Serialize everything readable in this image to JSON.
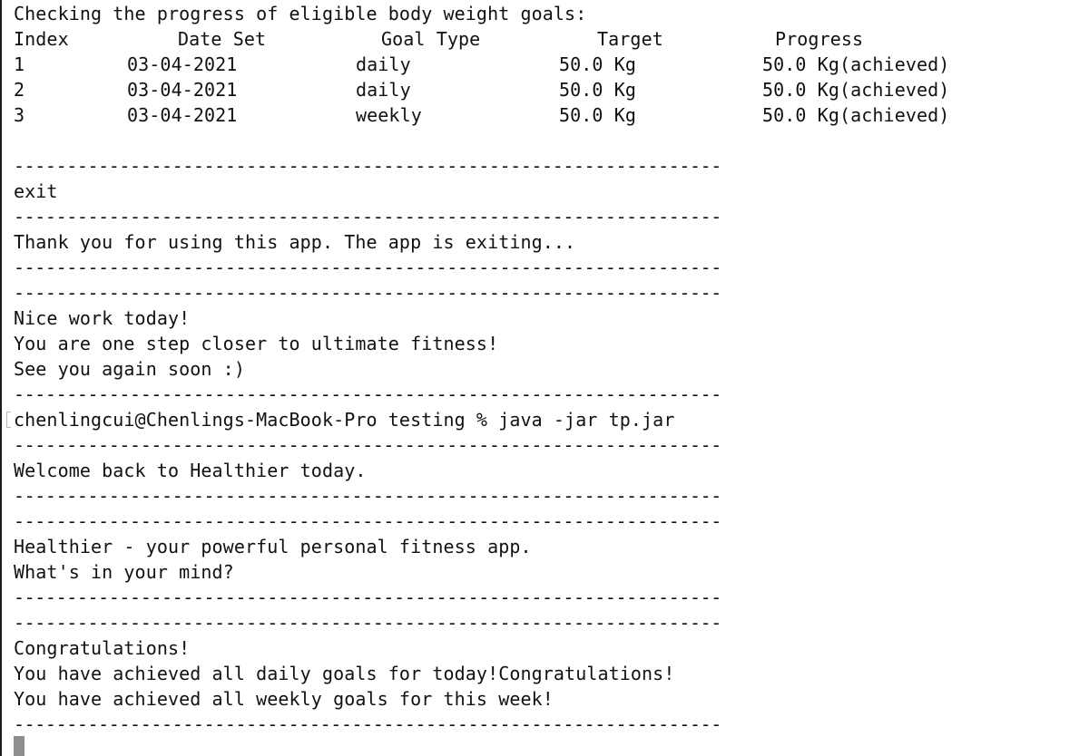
{
  "terminal": {
    "lines": {
      "heading": "Checking the progress of eligible body weight goals:",
      "exit_cmd": "exit",
      "thank_you": "Thank you for using this app. The app is exiting...",
      "nice_work": "Nice work today!",
      "closer": "You are one step closer to ultimate fitness!",
      "see_you": "See you again soon :)",
      "prompt": "chenlingcui@Chenlings-MacBook-Pro testing % java -jar tp.jar",
      "welcome_back": "Welcome back to Healthier today.",
      "app_intro": "Healthier - your powerful personal fitness app.",
      "question": "What's in your mind?",
      "congrats": "Congratulations!",
      "daily_done": "You have achieved all daily goals for today!Congratulations!",
      "weekly_done": "You have achieved all weekly goals for this week!"
    },
    "separator": "-------------------------------------------------------------------"
  },
  "goals_table": {
    "headers": {
      "index": "Index",
      "date": "Date Set",
      "type": "Goal Type",
      "target": "Target",
      "progress": "Progress"
    },
    "rows": [
      {
        "index": "1",
        "date": "03-04-2021",
        "type": "daily",
        "target": "50.0 Kg",
        "progress": "50.0 Kg(achieved)"
      },
      {
        "index": "2",
        "date": "03-04-2021",
        "type": "daily",
        "target": "50.0 Kg",
        "progress": "50.0 Kg(achieved)"
      },
      {
        "index": "3",
        "date": "03-04-2021",
        "type": "weekly",
        "target": "50.0 Kg",
        "progress": "50.0 Kg(achieved)"
      }
    ]
  }
}
